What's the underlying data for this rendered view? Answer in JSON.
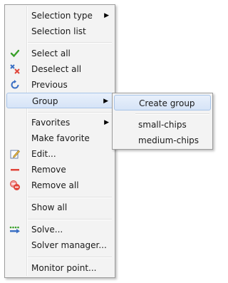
{
  "menu": {
    "items": [
      {
        "label": "Selection type",
        "icon": null,
        "submenu": true
      },
      {
        "label": "Selection list",
        "icon": null
      },
      {
        "label": "Select all",
        "icon": "check-icon"
      },
      {
        "label": "Deselect all",
        "icon": "deselect-icon"
      },
      {
        "label": "Previous",
        "icon": "refresh-icon"
      },
      {
        "label": "Group",
        "icon": null,
        "submenu": true,
        "state": "open"
      },
      {
        "label": "Favorites",
        "icon": null,
        "submenu": true
      },
      {
        "label": "Make favorite",
        "icon": null
      },
      {
        "label": "Edit...",
        "icon": "edit-icon"
      },
      {
        "label": "Remove",
        "icon": "minus-icon"
      },
      {
        "label": "Remove all",
        "icon": "remove-all-icon"
      },
      {
        "label": "Show all",
        "icon": null
      },
      {
        "label": "Solve...",
        "icon": "solve-icon"
      },
      {
        "label": "Solver manager...",
        "icon": null
      },
      {
        "label": "Monitor point...",
        "icon": null
      }
    ]
  },
  "submenu": {
    "items": [
      {
        "label": "Create group",
        "state": "hover"
      },
      {
        "label": "small-chips"
      },
      {
        "label": "medium-chips"
      }
    ]
  },
  "colors": {
    "check": "#3aa02a",
    "remove": "#e0453a",
    "deselect_blue": "#3a6fc4",
    "hover_border": "#a8c4e8"
  }
}
